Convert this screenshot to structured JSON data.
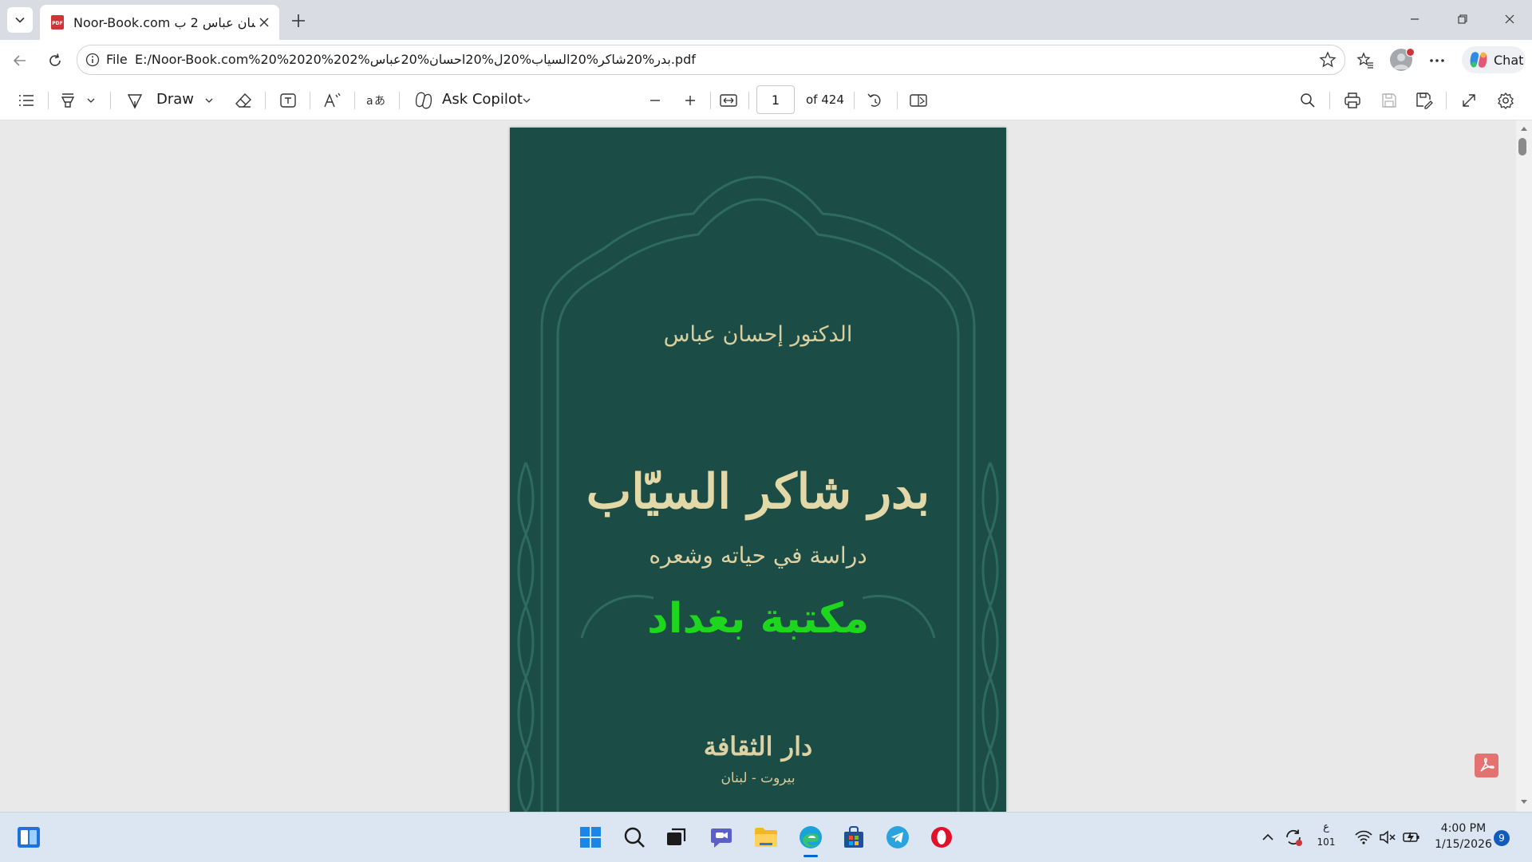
{
  "browser": {
    "tab": {
      "title": "Noor-Book.com ل احسان عباس 2 ب"
    },
    "address": {
      "scheme": "File",
      "url": "E:/Noor-Book.com%20%2020%202%بدر%20شاكر%20السياب%20ل%20احسان%20عباس.pdf"
    },
    "chat_label": "Chat"
  },
  "pdf_toolbar": {
    "draw_label": "Draw",
    "copilot_label": "Ask Copilot",
    "page_number": "1",
    "page_total": "of 424"
  },
  "document": {
    "author": "الدكتور إحسان عباس",
    "title": "بدر شاكر السيّاب",
    "subtitle": "دراسة في حياته وشعره",
    "watermark": "مكتبة بغداد",
    "publisher": "دار الثقافة",
    "city": "بيروت - لبنان",
    "cover_color": "#1b4c45",
    "ornament_color": "#2f6a60",
    "watermark_color": "#1ed61e"
  },
  "taskbar": {
    "keyboard_lang": "ع",
    "keyboard_layout": "101",
    "time": "4:00 PM",
    "date": "1/15/2026",
    "notification_count": "9"
  },
  "icons": {
    "edge": "edge-icon",
    "telegram": "telegram-icon",
    "opera": "opera-icon"
  }
}
